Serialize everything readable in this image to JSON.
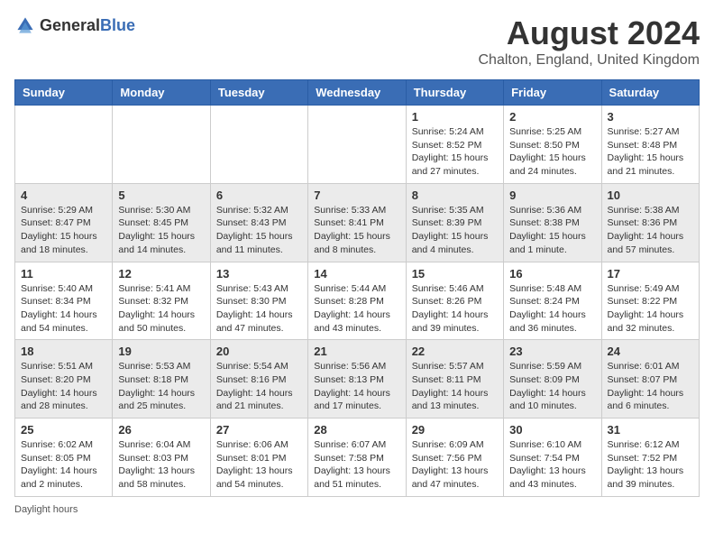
{
  "header": {
    "logo_general": "General",
    "logo_blue": "Blue",
    "title": "August 2024",
    "subtitle": "Chalton, England, United Kingdom"
  },
  "days_of_week": [
    "Sunday",
    "Monday",
    "Tuesday",
    "Wednesday",
    "Thursday",
    "Friday",
    "Saturday"
  ],
  "weeks": [
    [
      {
        "day": "",
        "info": ""
      },
      {
        "day": "",
        "info": ""
      },
      {
        "day": "",
        "info": ""
      },
      {
        "day": "",
        "info": ""
      },
      {
        "day": "1",
        "info": "Sunrise: 5:24 AM\nSunset: 8:52 PM\nDaylight: 15 hours and 27 minutes."
      },
      {
        "day": "2",
        "info": "Sunrise: 5:25 AM\nSunset: 8:50 PM\nDaylight: 15 hours and 24 minutes."
      },
      {
        "day": "3",
        "info": "Sunrise: 5:27 AM\nSunset: 8:48 PM\nDaylight: 15 hours and 21 minutes."
      }
    ],
    [
      {
        "day": "4",
        "info": "Sunrise: 5:29 AM\nSunset: 8:47 PM\nDaylight: 15 hours and 18 minutes."
      },
      {
        "day": "5",
        "info": "Sunrise: 5:30 AM\nSunset: 8:45 PM\nDaylight: 15 hours and 14 minutes."
      },
      {
        "day": "6",
        "info": "Sunrise: 5:32 AM\nSunset: 8:43 PM\nDaylight: 15 hours and 11 minutes."
      },
      {
        "day": "7",
        "info": "Sunrise: 5:33 AM\nSunset: 8:41 PM\nDaylight: 15 hours and 8 minutes."
      },
      {
        "day": "8",
        "info": "Sunrise: 5:35 AM\nSunset: 8:39 PM\nDaylight: 15 hours and 4 minutes."
      },
      {
        "day": "9",
        "info": "Sunrise: 5:36 AM\nSunset: 8:38 PM\nDaylight: 15 hours and 1 minute."
      },
      {
        "day": "10",
        "info": "Sunrise: 5:38 AM\nSunset: 8:36 PM\nDaylight: 14 hours and 57 minutes."
      }
    ],
    [
      {
        "day": "11",
        "info": "Sunrise: 5:40 AM\nSunset: 8:34 PM\nDaylight: 14 hours and 54 minutes."
      },
      {
        "day": "12",
        "info": "Sunrise: 5:41 AM\nSunset: 8:32 PM\nDaylight: 14 hours and 50 minutes."
      },
      {
        "day": "13",
        "info": "Sunrise: 5:43 AM\nSunset: 8:30 PM\nDaylight: 14 hours and 47 minutes."
      },
      {
        "day": "14",
        "info": "Sunrise: 5:44 AM\nSunset: 8:28 PM\nDaylight: 14 hours and 43 minutes."
      },
      {
        "day": "15",
        "info": "Sunrise: 5:46 AM\nSunset: 8:26 PM\nDaylight: 14 hours and 39 minutes."
      },
      {
        "day": "16",
        "info": "Sunrise: 5:48 AM\nSunset: 8:24 PM\nDaylight: 14 hours and 36 minutes."
      },
      {
        "day": "17",
        "info": "Sunrise: 5:49 AM\nSunset: 8:22 PM\nDaylight: 14 hours and 32 minutes."
      }
    ],
    [
      {
        "day": "18",
        "info": "Sunrise: 5:51 AM\nSunset: 8:20 PM\nDaylight: 14 hours and 28 minutes."
      },
      {
        "day": "19",
        "info": "Sunrise: 5:53 AM\nSunset: 8:18 PM\nDaylight: 14 hours and 25 minutes."
      },
      {
        "day": "20",
        "info": "Sunrise: 5:54 AM\nSunset: 8:16 PM\nDaylight: 14 hours and 21 minutes."
      },
      {
        "day": "21",
        "info": "Sunrise: 5:56 AM\nSunset: 8:13 PM\nDaylight: 14 hours and 17 minutes."
      },
      {
        "day": "22",
        "info": "Sunrise: 5:57 AM\nSunset: 8:11 PM\nDaylight: 14 hours and 13 minutes."
      },
      {
        "day": "23",
        "info": "Sunrise: 5:59 AM\nSunset: 8:09 PM\nDaylight: 14 hours and 10 minutes."
      },
      {
        "day": "24",
        "info": "Sunrise: 6:01 AM\nSunset: 8:07 PM\nDaylight: 14 hours and 6 minutes."
      }
    ],
    [
      {
        "day": "25",
        "info": "Sunrise: 6:02 AM\nSunset: 8:05 PM\nDaylight: 14 hours and 2 minutes."
      },
      {
        "day": "26",
        "info": "Sunrise: 6:04 AM\nSunset: 8:03 PM\nDaylight: 13 hours and 58 minutes."
      },
      {
        "day": "27",
        "info": "Sunrise: 6:06 AM\nSunset: 8:01 PM\nDaylight: 13 hours and 54 minutes."
      },
      {
        "day": "28",
        "info": "Sunrise: 6:07 AM\nSunset: 7:58 PM\nDaylight: 13 hours and 51 minutes."
      },
      {
        "day": "29",
        "info": "Sunrise: 6:09 AM\nSunset: 7:56 PM\nDaylight: 13 hours and 47 minutes."
      },
      {
        "day": "30",
        "info": "Sunrise: 6:10 AM\nSunset: 7:54 PM\nDaylight: 13 hours and 43 minutes."
      },
      {
        "day": "31",
        "info": "Sunrise: 6:12 AM\nSunset: 7:52 PM\nDaylight: 13 hours and 39 minutes."
      }
    ]
  ],
  "footer": "Daylight hours"
}
